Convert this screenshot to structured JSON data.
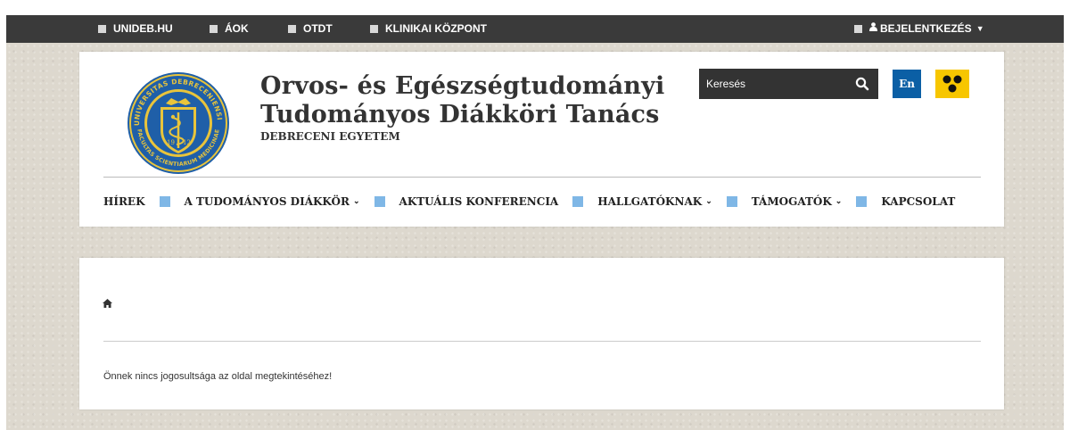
{
  "topbar": {
    "links": [
      "UNIDEB.HU",
      "ÁOK",
      "OTDT",
      "KLINIKAI KÖZPONT"
    ],
    "login_label": "BEJELENTKEZÉS"
  },
  "header": {
    "title_line1": "Orvos- és Egészségtudományi",
    "title_line2": "Tudományos Diákköri Tanács",
    "subtitle": "DEBRECENI EGYETEM",
    "logo_text_top": "UNIVERSITAS DEBRECENIENSIS",
    "logo_text_bottom": "FACULTAS SCIENTIARUM MEDICINAE",
    "search_placeholder": "Keresés",
    "lang_label": "En"
  },
  "nav": {
    "items": [
      "HÍREK",
      "A TUDOMÁNYOS DIÁKKÖR",
      "AKTUÁLIS KONFERENCIA",
      "HALLGATÓKNAK",
      "TÁMOGATÓK",
      "KAPCSOLAT"
    ]
  },
  "content": {
    "message": "Önnek nincs jogosultsága az oldal megtekintéséhez!"
  },
  "colors": {
    "topbar_bg": "#3a3a3a",
    "nav_separator": "#7fb7e6",
    "lang_button": "#0b5fa5",
    "accessibility_button": "#f7c600",
    "logo_blue": "#1f5fa8",
    "logo_gold": "#e9c43b"
  },
  "icons": [
    "home-icon",
    "search-icon",
    "user-icon",
    "accessibility-icon",
    "caret-down-icon"
  ]
}
